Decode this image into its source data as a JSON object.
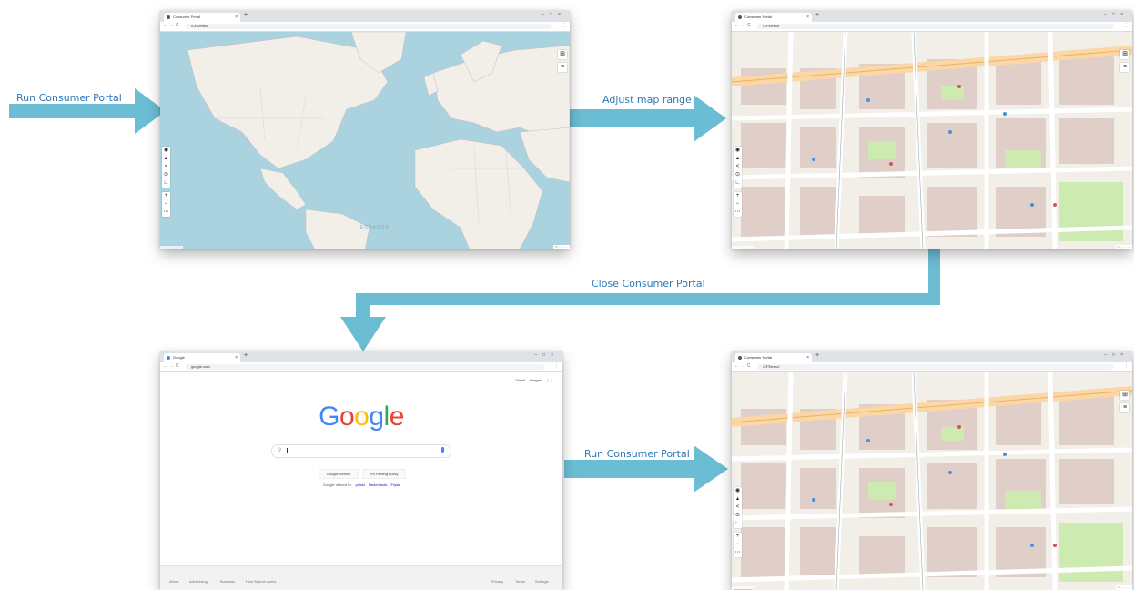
{
  "labels": {
    "run1": "Run Consumer Portal",
    "adjust": "Adjust map range",
    "close": "Close Consumer Portal",
    "run2": "Run Consumer Portal"
  },
  "portal_tab": "Consumer Portal",
  "portal_url": "/CPDemo/",
  "google_tab": "Google",
  "google_url": "google.com",
  "map_tool_icons": [
    "eye-icon",
    "elevation-icon",
    "share-icon",
    "target-icon",
    "measure-icon",
    "zoom-in-icon",
    "zoom-out-icon",
    "more-icon"
  ],
  "map_layer_icons": [
    "grid-icon",
    "menu-icon"
  ],
  "map_region_label": "ECUADOR",
  "google": {
    "top_links": [
      "Gmail",
      "Images"
    ],
    "search_button": "Google Search",
    "lucky_button": "I'm Feeling Lucky",
    "offered_in": "Google offered in:",
    "languages": [
      "polski",
      "Nederlands",
      "Frysk"
    ],
    "footer_left": [
      "About",
      "Advertising",
      "Business",
      "How Search works"
    ],
    "footer_right": [
      "Privacy",
      "Terms",
      "Settings"
    ]
  },
  "colors": {
    "arrow": "#6bbdd3",
    "label": "#2e78b6",
    "water": "#aad3df",
    "land": "#f2efe9",
    "google_blue": "#4285F4",
    "google_red": "#EA4335",
    "google_yellow": "#FBBC05",
    "google_green": "#34A853"
  }
}
